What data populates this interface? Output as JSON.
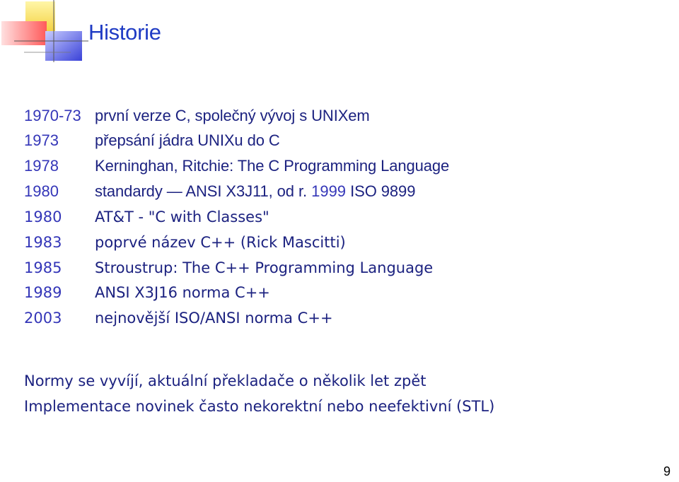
{
  "slide": {
    "title": "Historie",
    "page_number": "9",
    "timeline": [
      {
        "year": "1970-73",
        "text": "první verze C, společný vývoj s UNIXem"
      },
      {
        "year": "1973",
        "text": "přepsání jádra UNIXu do C"
      },
      {
        "year": "1978",
        "text": "Kerninghan, Ritchie: The C Programming Language"
      },
      {
        "year": "1980",
        "text": "standardy — ANSI X3J11, od r.",
        "highlight_year": "1999",
        "tail": "ISO 9899"
      },
      {
        "year": "1980",
        "text": "AT&T - \"C with Classes\""
      },
      {
        "year": "1983",
        "text": "poprvé název C++ (Rick Mascitti)"
      },
      {
        "year": "1985",
        "text": "Stroustrup: The C++ Programming Language"
      },
      {
        "year": "1989",
        "text": "ANSI X3J16 norma C++"
      },
      {
        "year": "2003",
        "text": "nejnovější ISO/ANSI norma C++"
      }
    ],
    "notes": [
      "Normy se vyvíjí, aktuální překladače o několik let zpět",
      "Implementace novinek často nekorektní nebo neefektivní (STL)"
    ],
    "colors": {
      "title": "#1f3bc4",
      "year": "#3436b8",
      "text": "#1c2280"
    }
  }
}
